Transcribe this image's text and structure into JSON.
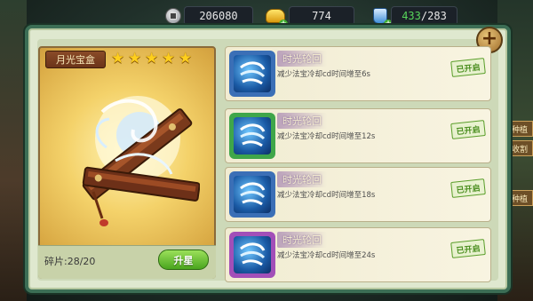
{
  "resources": {
    "silver": "206080",
    "gold": "774",
    "stamina": "433/283",
    "stamina_current": "433",
    "stamina_max": "/283"
  },
  "artifact": {
    "name": "月光宝盒",
    "stars": 5,
    "fragments_label": "碎片:28/20",
    "upgrade_label": "升星"
  },
  "skills": [
    {
      "name": "时光轮回",
      "desc": "减少法宝冷却cd时间增至6s",
      "status": "已开启",
      "frame_color": "#3b6fb6"
    },
    {
      "name": "时光轮回",
      "desc": "减少法宝冷却cd时间增至12s",
      "status": "已开启",
      "frame_color": "#3fa64a"
    },
    {
      "name": "时光轮回",
      "desc": "减少法宝冷却cd时间增至18s",
      "status": "已开启",
      "frame_color": "#3b6fb6"
    },
    {
      "name": "时光轮回",
      "desc": "减少法宝冷却cd时间增至24s",
      "status": "已开启",
      "frame_color": "#a24fb8"
    }
  ],
  "side_tags": [
    "种植",
    "收割",
    "种植"
  ],
  "icons": {
    "silver": "silver-coin-icon",
    "gold": "gold-ingot-icon",
    "stamina": "potion-icon",
    "add": "plus-icon"
  }
}
